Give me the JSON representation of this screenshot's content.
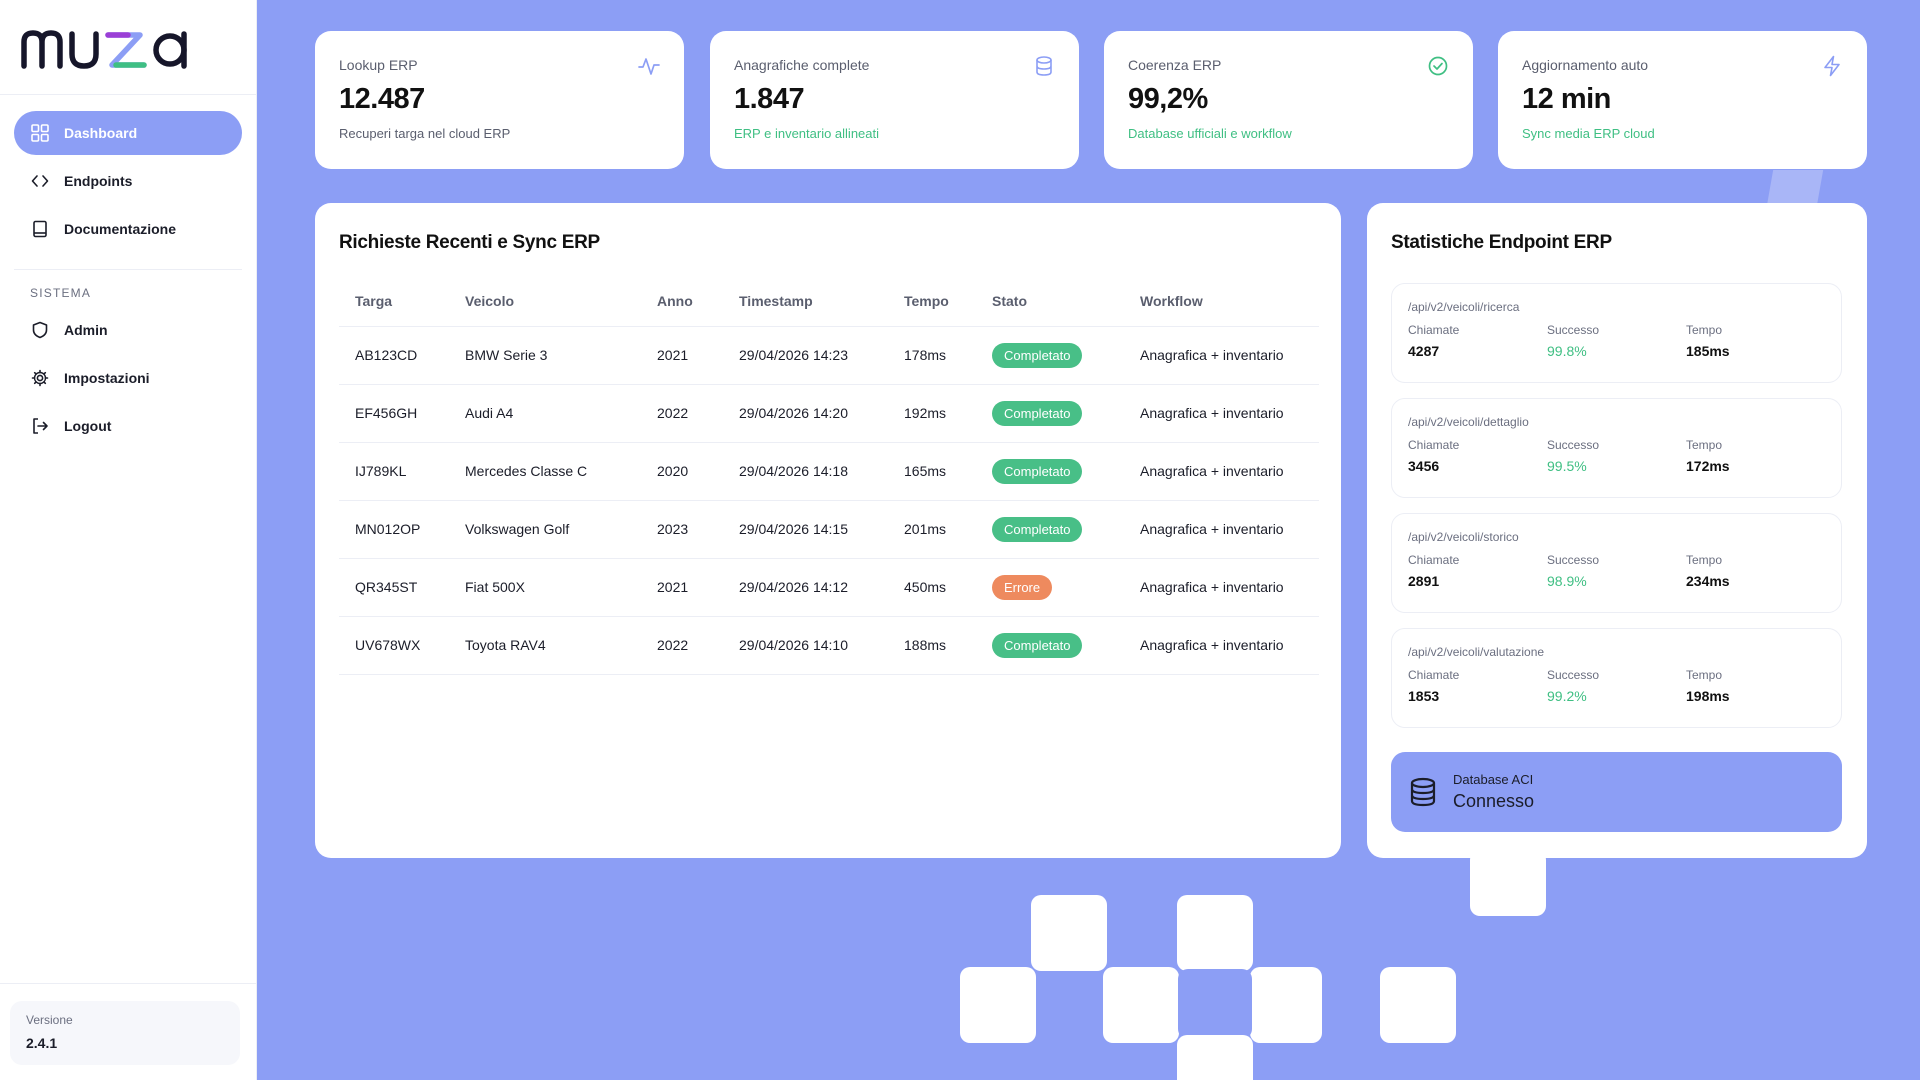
{
  "brand": {
    "logo_text": "muza"
  },
  "sidebar": {
    "items": [
      {
        "label": "Dashboard",
        "icon": "grid-icon",
        "active": true
      },
      {
        "label": "Endpoints",
        "icon": "code-icon",
        "active": false
      },
      {
        "label": "Documentazione",
        "icon": "book-icon",
        "active": false
      }
    ],
    "section_label": "SISTEMA",
    "system_items": [
      {
        "label": "Admin",
        "icon": "shield-icon"
      },
      {
        "label": "Impostazioni",
        "icon": "gear-icon"
      },
      {
        "label": "Logout",
        "icon": "logout-icon"
      }
    ],
    "version_label": "Versione",
    "version_value": "2.4.1"
  },
  "stats": [
    {
      "title": "Lookup ERP",
      "value": "12.487",
      "sub": "Recuperi targa nel cloud ERP",
      "icon": "activity-icon"
    },
    {
      "title": "Anagrafiche complete",
      "value": "1.847",
      "sub": "ERP e inventario allineati",
      "icon": "database-icon"
    },
    {
      "title": "Coerenza ERP",
      "value": "99,2%",
      "sub": "Database ufficiali e workflow",
      "icon": "check-circle-icon"
    },
    {
      "title": "Aggiornamento auto",
      "value": "12 min",
      "sub": "Sync media ERP cloud",
      "icon": "lightning-icon"
    }
  ],
  "requests": {
    "title": "Richieste Recenti e Sync ERP",
    "columns": [
      "Targa",
      "Veicolo",
      "Anno",
      "Timestamp",
      "Tempo",
      "Stato",
      "Workflow"
    ],
    "rows": [
      {
        "targa": "AB123CD",
        "veicolo": "BMW Serie 3",
        "anno": "2021",
        "timestamp": "29/04/2026 14:23",
        "tempo": "178ms",
        "stato": "Completato",
        "workflow": "Anagrafica + inventario"
      },
      {
        "targa": "EF456GH",
        "veicolo": "Audi A4",
        "anno": "2022",
        "timestamp": "29/04/2026 14:20",
        "tempo": "192ms",
        "stato": "Completato",
        "workflow": "Anagrafica + inventario"
      },
      {
        "targa": "IJ789KL",
        "veicolo": "Mercedes Classe C",
        "anno": "2020",
        "timestamp": "29/04/2026 14:18",
        "tempo": "165ms",
        "stato": "Completato",
        "workflow": "Anagrafica + inventario"
      },
      {
        "targa": "MN012OP",
        "veicolo": "Volkswagen Golf",
        "anno": "2023",
        "timestamp": "29/04/2026 14:15",
        "tempo": "201ms",
        "stato": "Completato",
        "workflow": "Anagrafica + inventario"
      },
      {
        "targa": "QR345ST",
        "veicolo": "Fiat 500X",
        "anno": "2021",
        "timestamp": "29/04/2026 14:12",
        "tempo": "450ms",
        "stato": "Errore",
        "workflow": "Anagrafica + inventario"
      },
      {
        "targa": "UV678WX",
        "veicolo": "Toyota RAV4",
        "anno": "2022",
        "timestamp": "29/04/2026 14:10",
        "tempo": "188ms",
        "stato": "Completato",
        "workflow": "Anagrafica + inventario"
      }
    ]
  },
  "endpoints": {
    "title": "Statistiche Endpoint ERP",
    "labels": {
      "calls": "Chiamate",
      "success": "Successo",
      "time": "Tempo"
    },
    "items": [
      {
        "path": "/api/v2/veicoli/ricerca",
        "calls": "4287",
        "success": "99.8%",
        "time": "185ms"
      },
      {
        "path": "/api/v2/veicoli/dettaglio",
        "calls": "3456",
        "success": "99.5%",
        "time": "172ms"
      },
      {
        "path": "/api/v2/veicoli/storico",
        "calls": "2891",
        "success": "98.9%",
        "time": "234ms"
      },
      {
        "path": "/api/v2/veicoli/valutazione",
        "calls": "1853",
        "success": "99.2%",
        "time": "198ms"
      }
    ],
    "database": {
      "label": "Database ACI",
      "status": "Connesso",
      "icon": "database-icon"
    }
  },
  "colors": {
    "background": "#8c9ef5",
    "accent": "#8c9ef5",
    "success": "#48bf87",
    "error": "#ee8a5e",
    "success_text": "#3fbf83"
  }
}
